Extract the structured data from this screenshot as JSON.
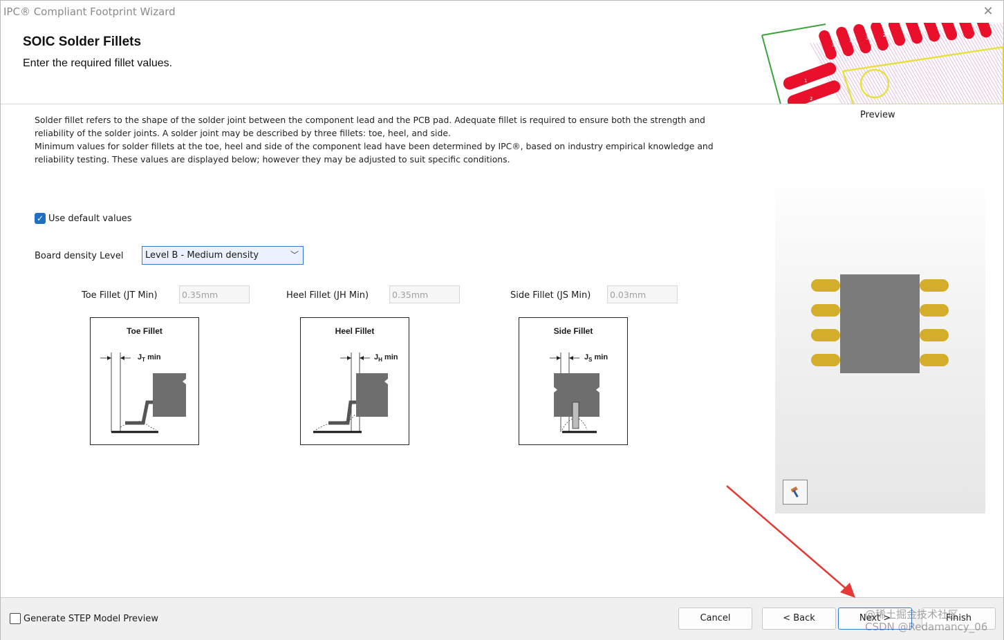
{
  "window": {
    "title": "IPC® Compliant Footprint Wizard"
  },
  "header": {
    "title": "SOIC Solder Fillets",
    "subtitle": "Enter the required fillet values."
  },
  "description": {
    "lines": [
      "Solder fillet refers to the shape of the solder joint between the component lead and the PCB pad. Adequate fillet is required to ensure both the strength and",
      "reliability of the solder joints. A solder joint may be described by three fillets: toe, heel, and side.",
      "Minimum values for solder fillets at the toe, heel and side of the component lead have been determined by IPC®, based on industry empirical knowledge and",
      "reliability testing. These values are displayed below; however they may be adjusted to suit specific conditions."
    ]
  },
  "defaults": {
    "label": "Use default values",
    "checked": true
  },
  "density": {
    "label": "Board density Level",
    "value": "Level B - Medium density"
  },
  "fillets": {
    "toe": {
      "label": "Toe Fillet (JT Min)",
      "value": "0.35mm",
      "diagram_title": "Toe Fillet",
      "sym": "J",
      "sub": "T",
      "suffix": "min"
    },
    "heel": {
      "label": "Heel Fillet (JH Min)",
      "value": "0.35mm",
      "diagram_title": "Heel Fillet",
      "sym": "J",
      "sub": "H",
      "suffix": "min"
    },
    "side": {
      "label": "Side Fillet (JS Min)",
      "value": "0.03mm",
      "diagram_title": "Side Fillet",
      "sym": "J",
      "sub": "S",
      "suffix": "min"
    }
  },
  "header_art": {
    "pad_numbers": [
      "32",
      "31",
      "30",
      "29",
      "1",
      "2"
    ]
  },
  "preview": {
    "label": "Preview"
  },
  "footer": {
    "step_label": "Generate STEP Model Preview",
    "step_checked": false,
    "buttons": {
      "cancel": "Cancel",
      "back": "< Back",
      "next": "Next >",
      "finish": "Finish"
    }
  },
  "watermark": {
    "line1": "@稀土掘金技术社区",
    "line2": "CSDN @Redamancy_06"
  },
  "colors": {
    "accent": "#2f7ad6",
    "pad_gold": "#d4ad2a",
    "body_gray": "#7b7b7b",
    "pcb_red": "#e8102a",
    "annotation_arrow": "#e53935"
  }
}
